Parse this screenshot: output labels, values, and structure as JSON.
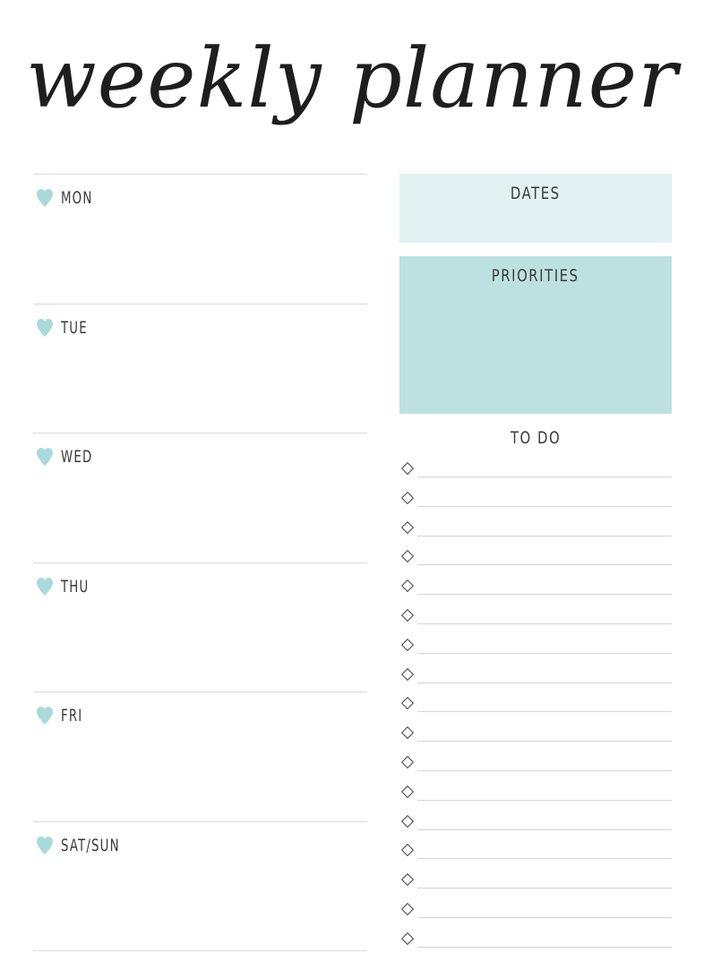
{
  "title": "weekly planner",
  "accent_colors": {
    "heart": "#a9dada",
    "dates_fill": "#e2f1f1",
    "priorities_fill": "#bde1e1"
  },
  "days": [
    {
      "label": "MON",
      "icon": "heart-icon"
    },
    {
      "label": "TUE",
      "icon": "heart-icon"
    },
    {
      "label": "WED",
      "icon": "heart-icon"
    },
    {
      "label": "THU",
      "icon": "heart-icon"
    },
    {
      "label": "FRI",
      "icon": "heart-icon"
    },
    {
      "label": "SAT/SUN",
      "icon": "heart-icon"
    }
  ],
  "dates_heading": "DATES",
  "priorities_heading": "PRIORITIES",
  "todo": {
    "heading": "TO DO",
    "item_icon": "diamond-bullet-icon",
    "item_count": 17
  }
}
